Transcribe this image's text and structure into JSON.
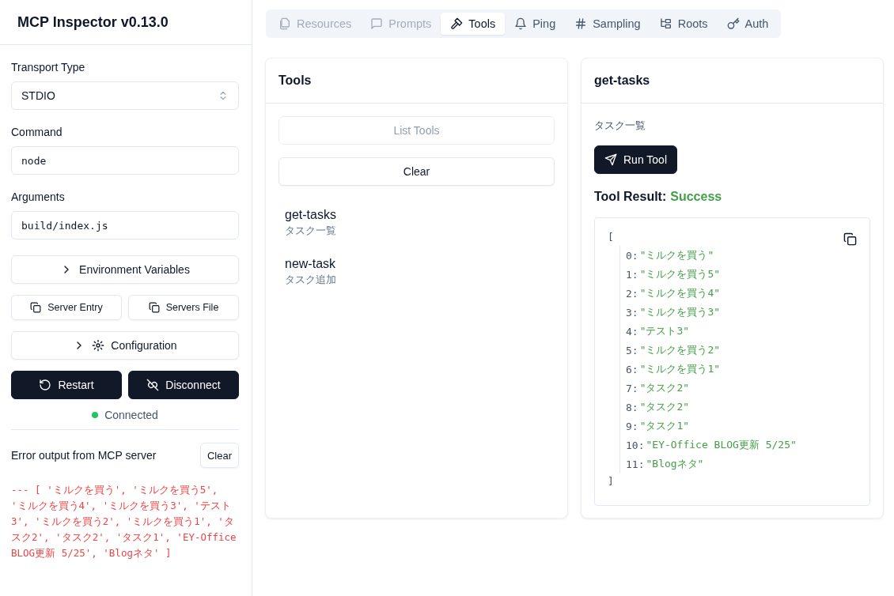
{
  "sidebar": {
    "title": "MCP Inspector v0.13.0",
    "transport": {
      "label": "Transport Type",
      "value": "STDIO"
    },
    "command": {
      "label": "Command",
      "value": "node"
    },
    "arguments": {
      "label": "Arguments",
      "value": "build/index.js"
    },
    "env_button": "Environment Variables",
    "copy_buttons": [
      "Server Entry",
      "Servers File"
    ],
    "config_button": "Configuration",
    "restart_button": "Restart",
    "disconnect_button": "Disconnect",
    "connection": {
      "status": "Connected",
      "connected": true
    },
    "error_output": {
      "title": "Error output from MCP server",
      "clear_button": "Clear",
      "text": "--- [ 'ミルクを買う', 'ミルクを買う5', 'ミルクを買う4', 'ミルクを買う3', 'テスト3', 'ミルクを買う2', 'ミルクを買う1', 'タスク2', 'タスク2', 'タスク1', 'EY-Office BLOG更新 5/25', 'Blogネタ' ]"
    }
  },
  "tabs": [
    {
      "label": "Resources",
      "kind": "resources",
      "selected": false,
      "disabled": true
    },
    {
      "label": "Prompts",
      "kind": "prompts",
      "selected": false,
      "disabled": true
    },
    {
      "label": "Tools",
      "kind": "tools",
      "selected": true,
      "disabled": false
    },
    {
      "label": "Ping",
      "kind": "ping",
      "selected": false,
      "disabled": false
    },
    {
      "label": "Sampling",
      "kind": "sampling",
      "selected": false,
      "disabled": false
    },
    {
      "label": "Roots",
      "kind": "roots",
      "selected": false,
      "disabled": false
    },
    {
      "label": "Auth",
      "kind": "auth",
      "selected": false,
      "disabled": false
    }
  ],
  "tools_panel": {
    "title": "Tools",
    "list_button": {
      "label": "List Tools",
      "disabled": true
    },
    "clear_button": "Clear",
    "tools": [
      {
        "name": "get-tasks",
        "description": "タスク一覧"
      },
      {
        "name": "new-task",
        "description": "タスク追加"
      }
    ]
  },
  "tool_detail": {
    "title": "get-tasks",
    "description": "タスク一覧",
    "run_button": "Run Tool",
    "result_label": "Tool Result:",
    "result_status": "Success",
    "result": {
      "open": "[",
      "close": "]",
      "items": [
        {
          "index": "0:",
          "value": "\"ミルクを買う\""
        },
        {
          "index": "1:",
          "value": "\"ミルクを買う5\""
        },
        {
          "index": "2:",
          "value": "\"ミルクを買う4\""
        },
        {
          "index": "3:",
          "value": "\"ミルクを買う3\""
        },
        {
          "index": "4:",
          "value": "\"テスト3\""
        },
        {
          "index": "5:",
          "value": "\"ミルクを買う2\""
        },
        {
          "index": "6:",
          "value": "\"ミルクを買う1\""
        },
        {
          "index": "7:",
          "value": "\"タスク2\""
        },
        {
          "index": "8:",
          "value": "\"タスク2\""
        },
        {
          "index": "9:",
          "value": "\"タスク1\""
        },
        {
          "index": "10:",
          "value": "\"EY-Office BLOG更新 5/25\""
        },
        {
          "index": "11:",
          "value": "\"Blogネタ\""
        }
      ]
    }
  }
}
